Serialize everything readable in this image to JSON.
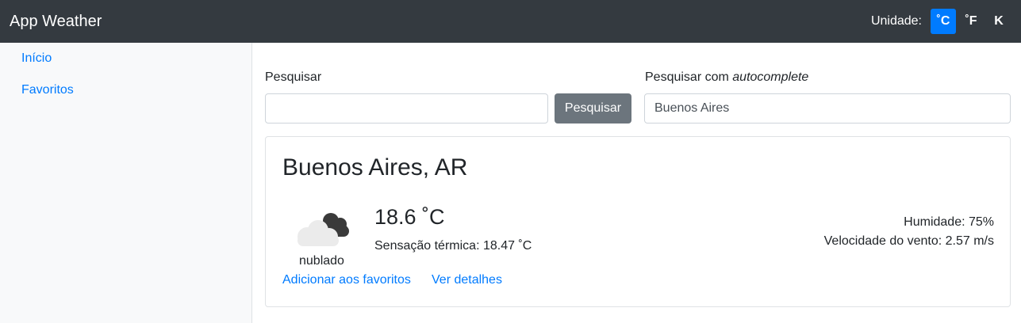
{
  "navbar": {
    "brand": "App Weather",
    "unit_label": "Unidade:",
    "units": [
      "˚C",
      "˚F",
      "K"
    ],
    "active_unit": "˚C",
    "bg_color": "#343a40",
    "accent_color": "#007bff"
  },
  "sidebar": {
    "items": [
      {
        "label": "Início"
      },
      {
        "label": "Favoritos"
      }
    ]
  },
  "search": {
    "label": "Pesquisar",
    "value": "",
    "button_label": "Pesquisar"
  },
  "autocomplete": {
    "label_prefix": "Pesquisar com ",
    "label_emphasis": "autocomplete",
    "value": "Buenos Aires"
  },
  "weather": {
    "city": "Buenos Aires, AR",
    "icon": "cloudy-icon",
    "description": "nublado",
    "temperature": "18.6 ˚C",
    "feels_like": "Sensação térmica: 18.47 ˚C",
    "humidity": "Humidade: 75%",
    "wind": "Velocidade do vento: 2.57 m/s",
    "add_favorite_label": "Adicionar aos favoritos",
    "details_label": "Ver detalhes"
  }
}
